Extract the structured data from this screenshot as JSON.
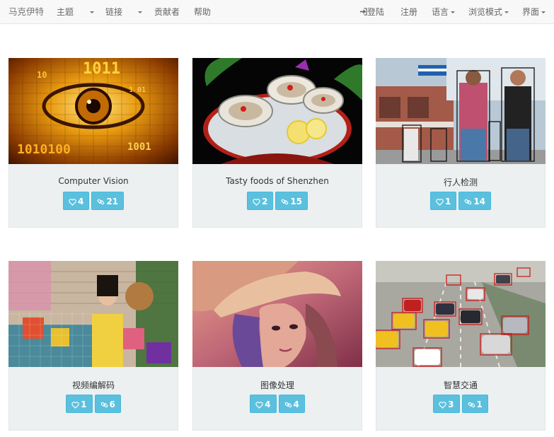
{
  "navbar": {
    "brand": "马克伊特",
    "topics": "主题",
    "links": "链接",
    "contributors": "贡献者",
    "help": "帮助",
    "login": "登陆",
    "register": "注册",
    "language": "语言",
    "browse_mode": "浏览模式",
    "interface": "界面"
  },
  "cards": [
    {
      "title": "Computer Vision",
      "likes": "4",
      "links": "21",
      "image": "computer-vision-eye"
    },
    {
      "title": "Tasty foods of Shenzhen",
      "likes": "2",
      "links": "15",
      "image": "oysters-dish"
    },
    {
      "title": "行人检测",
      "likes": "1",
      "links": "14",
      "image": "pedestrians-street"
    },
    {
      "title": "视频编解码",
      "likes": "1",
      "links": "6",
      "image": "girl-with-toys"
    },
    {
      "title": "图像处理",
      "likes": "4",
      "links": "4",
      "image": "lena"
    },
    {
      "title": "智慧交通",
      "likes": "3",
      "links": "1",
      "image": "highway-traffic"
    }
  ],
  "colors": {
    "accent_button": "#5bc0de",
    "card_background": "#ecf0f1",
    "navbar_background": "#f8f8f8"
  }
}
